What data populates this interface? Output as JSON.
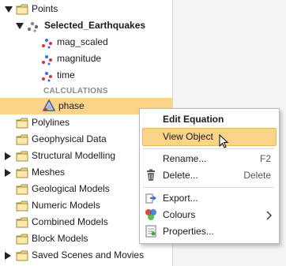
{
  "tree": {
    "points_label": "Points",
    "selected_earthquakes_label": "Selected_Earthquakes",
    "mag_scaled_label": "mag_scaled",
    "magnitude_label": "magnitude",
    "time_label": "time",
    "calculations_header": "CALCULATIONS",
    "phase_label": "phase",
    "polylines_label": "Polylines",
    "geophysical_label": "Geophysical Data",
    "structural_label": "Structural Modelling",
    "meshes_label": "Meshes",
    "geological_label": "Geological Models",
    "numeric_label": "Numeric Models",
    "combined_label": "Combined Models",
    "block_label": "Block Models",
    "saved_scenes_label": "Saved Scenes and Movies"
  },
  "menu": {
    "edit_equation": "Edit Equation",
    "view_object": "View Object",
    "rename": "Rename...",
    "rename_shortcut": "F2",
    "delete": "Delete...",
    "delete_shortcut": "Delete",
    "export": "Export...",
    "colours": "Colours",
    "properties": "Properties..."
  },
  "colors": {
    "selection": "#fbd48a",
    "folder": "#f2d98b",
    "folder_border": "#a08a3c"
  }
}
